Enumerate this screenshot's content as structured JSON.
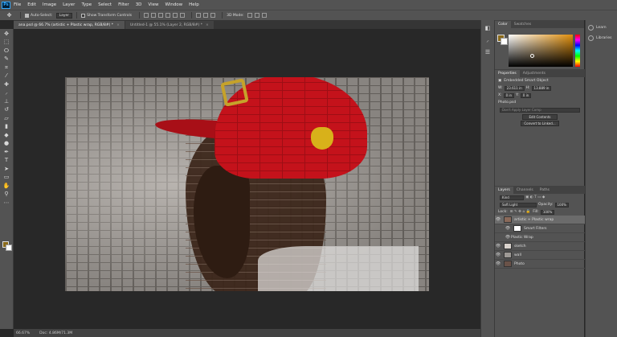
{
  "menubar": {
    "logo": "Ps",
    "items": [
      "File",
      "Edit",
      "Image",
      "Layer",
      "Type",
      "Select",
      "Filter",
      "3D",
      "View",
      "Window",
      "Help"
    ]
  },
  "options": {
    "auto_select": "Auto-Select:",
    "auto_select_value": "Layer",
    "show_transform": "Show Transform Controls",
    "mode_3d": "3D Mode:"
  },
  "tabs": [
    {
      "label": "ana.psd @ 66.7% (artistic + Plastic wrap, RGB/8#) *"
    },
    {
      "label": "Untitled-1 @ 55.1% (Layer 2, RGB/8#) *"
    }
  ],
  "colors_panel": {
    "tabs": [
      "Color",
      "Swatches"
    ],
    "foreground": "#8a6a1a",
    "background": "#ffffff"
  },
  "properties": {
    "tabs": [
      "Properties",
      "Adjustments"
    ],
    "title": "Embedded Smart Object",
    "w_label": "W:",
    "w": "23.611 in",
    "h_label": "H:",
    "h": "13.889 in",
    "x_label": "X:",
    "x": "0 in",
    "y_label": "Y:",
    "y": "0 in",
    "file": "Photo.psd",
    "layer_comp": "Don't Apply Layer Comp",
    "edit_btn": "Edit Contents",
    "convert_btn": "Convert to Linked..."
  },
  "layers_panel": {
    "tabs": [
      "Layers",
      "Channels",
      "Paths"
    ],
    "kind": "Kind",
    "blend_mode": "Soft Light",
    "opacity_label": "Opacity:",
    "opacity": "100%",
    "lock_label": "Lock:",
    "fill_label": "Fill:",
    "fill": "100%",
    "layers": [
      {
        "name": "artistic + Plastic wrap",
        "selected": true
      },
      {
        "name": "Smart Filters",
        "sub": true
      },
      {
        "name": "Plastic Wrap",
        "sub": true
      },
      {
        "name": "sketch"
      },
      {
        "name": "wall"
      },
      {
        "name": "Photo"
      }
    ]
  },
  "libraries": {
    "items": [
      "Learn",
      "Libraries"
    ]
  },
  "status": {
    "zoom": "66.67%",
    "doc": "Doc: 4.86M/71.3M"
  }
}
